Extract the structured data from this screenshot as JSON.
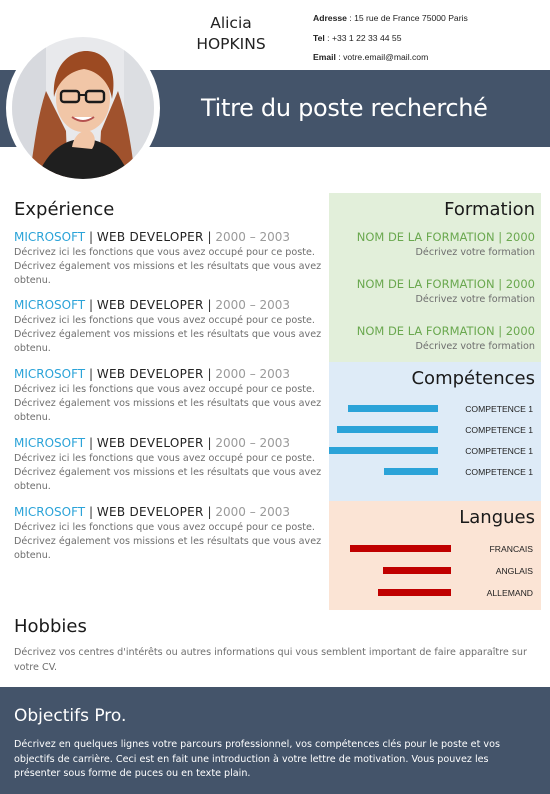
{
  "header": {
    "first_name": "Alicia",
    "last_name": "HOPKINS",
    "contact": {
      "address_label": "Adresse",
      "address_value": " : 15 rue de France 75000 Paris",
      "tel_label": "Tel",
      "tel_value": " : +33 1 22 33 44 55",
      "email_label": "Email",
      "email_value": " : votre.email@mail.com"
    },
    "job_title": "Titre du poste recherché"
  },
  "colors": {
    "banner": "#44546a",
    "accent_blue": "#2ba3d8",
    "accent_green": "#6aa84f",
    "language_red": "#c00000",
    "formation_bg": "#e2efda",
    "competences_bg": "#deebf7",
    "langues_bg": "#fbe4d5"
  },
  "experience": {
    "title": "Expérience",
    "items": [
      {
        "company": "MICROSOFT",
        "separator": " | ",
        "role": "WEB  DEVELOPER",
        "separator2": " | ",
        "dates": "2000 – 2003",
        "description": "Décrivez ici les fonctions que vous avez occupé pour ce poste. Décrivez également vos missions et les résultats que vous avez obtenu."
      },
      {
        "company": "MICROSOFT",
        "separator": " | ",
        "role": "WEB  DEVELOPER",
        "separator2": " | ",
        "dates": "2000 – 2003",
        "description": "Décrivez ici les fonctions que vous avez occupé pour ce poste. Décrivez également vos missions et les résultats que vous avez obtenu."
      },
      {
        "company": "MICROSOFT",
        "separator": " | ",
        "role": "WEB  DEVELOPER",
        "separator2": " | ",
        "dates": "2000 – 2003",
        "description": "Décrivez ici les fonctions que vous avez occupé pour ce poste. Décrivez également vos missions et les résultats que vous avez obtenu."
      },
      {
        "company": "MICROSOFT",
        "separator": " | ",
        "role": "WEB  DEVELOPER",
        "separator2": " | ",
        "dates": "2000 – 2003",
        "description": "Décrivez ici les fonctions que vous avez occupé pour ce poste. Décrivez également vos missions et les résultats que vous avez obtenu."
      },
      {
        "company": "MICROSOFT",
        "separator": " | ",
        "role": "WEB  DEVELOPER",
        "separator2": " | ",
        "dates": "2000 – 2003",
        "description": "Décrivez ici les fonctions que vous avez occupé pour ce poste. Décrivez également vos missions et les résultats que vous avez obtenu."
      }
    ]
  },
  "formation": {
    "title": "Formation",
    "items": [
      {
        "name": "NOM DE LA FORMATION | 2000",
        "description": "Décrivez votre formation"
      },
      {
        "name": "NOM DE LA FORMATION | 2000",
        "description": "Décrivez votre formation"
      },
      {
        "name": "NOM DE LA FORMATION | 2000",
        "description": "Décrivez votre formation"
      }
    ]
  },
  "competences": {
    "title": "Compétences",
    "items": [
      {
        "label": "COMPETENCE 1",
        "level": 0.56
      },
      {
        "label": "COMPETENCE 1",
        "level": 0.63
      },
      {
        "label": "COMPETENCE 1",
        "level": 0.68
      },
      {
        "label": "COMPETENCE 1",
        "level": 0.34
      }
    ]
  },
  "langues": {
    "title": "Langues",
    "items": [
      {
        "label": "FRANCAIS",
        "level": 0.65
      },
      {
        "label": "ANGLAIS",
        "level": 0.44
      },
      {
        "label": "ALLEMAND",
        "level": 0.47
      }
    ]
  },
  "hobbies": {
    "title": "Hobbies",
    "text": "Décrivez vos centres d'intérêts ou autres informations qui vous semblent important de faire apparaître sur votre CV."
  },
  "objectifs": {
    "title": "Objectifs Pro.",
    "text": "Décrivez en quelques lignes votre parcours professionnel, vos compétences clés pour le poste et vos objectifs de carrière. Ceci est en fait une introduction à votre lettre de motivation. Vous pouvez les présenter sous forme de puces ou en texte plain."
  }
}
